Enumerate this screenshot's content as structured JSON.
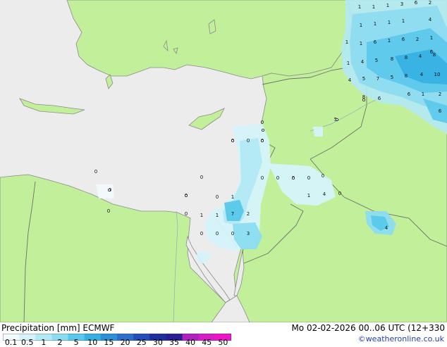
{
  "legend": {
    "title": "Precipitation [mm]  ECMWF",
    "run_info": "Mo 02-02-2026 00..06 UTC (12+330",
    "credit": "©weatheronline.co.uk",
    "ticks": [
      "0.1",
      "0.5",
      "1",
      "2",
      "5",
      "10",
      "15",
      "20",
      "25",
      "30",
      "35",
      "40",
      "45",
      "50"
    ],
    "colors": [
      "#f2fbff",
      "#d6f3fb",
      "#b2e9f6",
      "#8cdcf1",
      "#5ac8ea",
      "#34b0e2",
      "#2d8fd6",
      "#2a6fca",
      "#244fb8",
      "#1f2f9c",
      "#2a1e94",
      "#b01fc0",
      "#d41fc8",
      "#f014c8"
    ]
  },
  "colors": {
    "sea": "#ececec",
    "land": "#c2f09a",
    "border": "#6f6f6f",
    "coast": "#8a8a8a"
  },
  "labels": {
    "east": [
      "1",
      "1",
      "1",
      "3",
      "6",
      "2",
      "1",
      "1",
      "1",
      "1",
      "4",
      "1",
      "1",
      "6",
      "1",
      "6",
      "2",
      "1",
      "1",
      "4",
      "5",
      "8",
      "8",
      "4",
      "8",
      "4",
      "5",
      "7",
      "5",
      "4",
      "10",
      "1",
      "6",
      "6",
      "8",
      "6",
      "8",
      "2",
      "5",
      "0",
      "4",
      "6"
    ],
    "levant": [
      "0",
      "0",
      "0",
      "0",
      "0",
      "0",
      "0",
      "0",
      "0",
      "0",
      "1",
      "0",
      "0",
      "0",
      "0",
      "1",
      "1",
      "7",
      "2",
      "0",
      "0",
      "0",
      "3",
      "1",
      "0",
      "0",
      "4"
    ]
  }
}
